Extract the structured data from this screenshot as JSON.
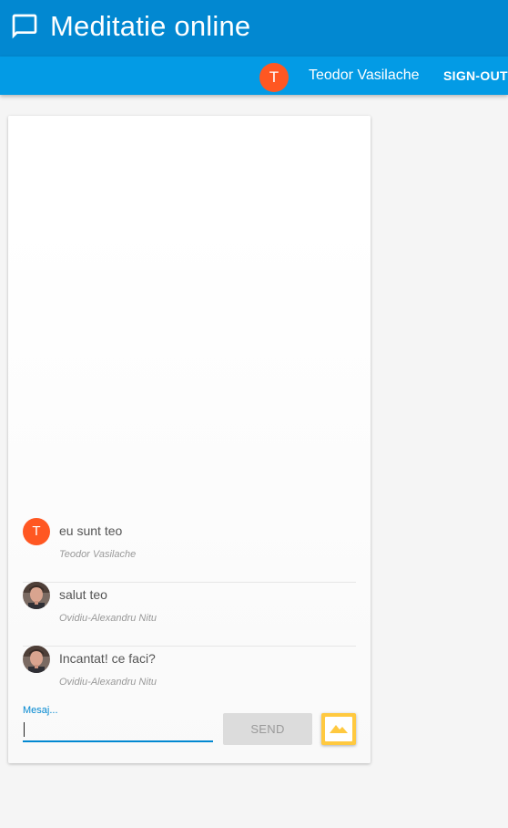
{
  "app": {
    "title": "Meditatie online",
    "icon": "chat-bubble-icon",
    "accent_color": "#0288d1"
  },
  "user": {
    "avatar_letter": "T",
    "name": "Teodor Vasilache",
    "signout_label": "SIGN-OUT"
  },
  "messages": [
    {
      "avatar_type": "letter",
      "avatar_letter": "T",
      "text": "eu sunt teo",
      "author": "Teodor Vasilache"
    },
    {
      "avatar_type": "photo",
      "text": "salut teo",
      "author": "Ovidiu-Alexandru Nitu"
    },
    {
      "avatar_type": "photo",
      "text": "Incantat! ce faci?",
      "author": "Ovidiu-Alexandru Nitu"
    }
  ],
  "composer": {
    "label": "Mesaj...",
    "value": "",
    "send_label": "SEND",
    "image_button_icon": "image-icon"
  }
}
